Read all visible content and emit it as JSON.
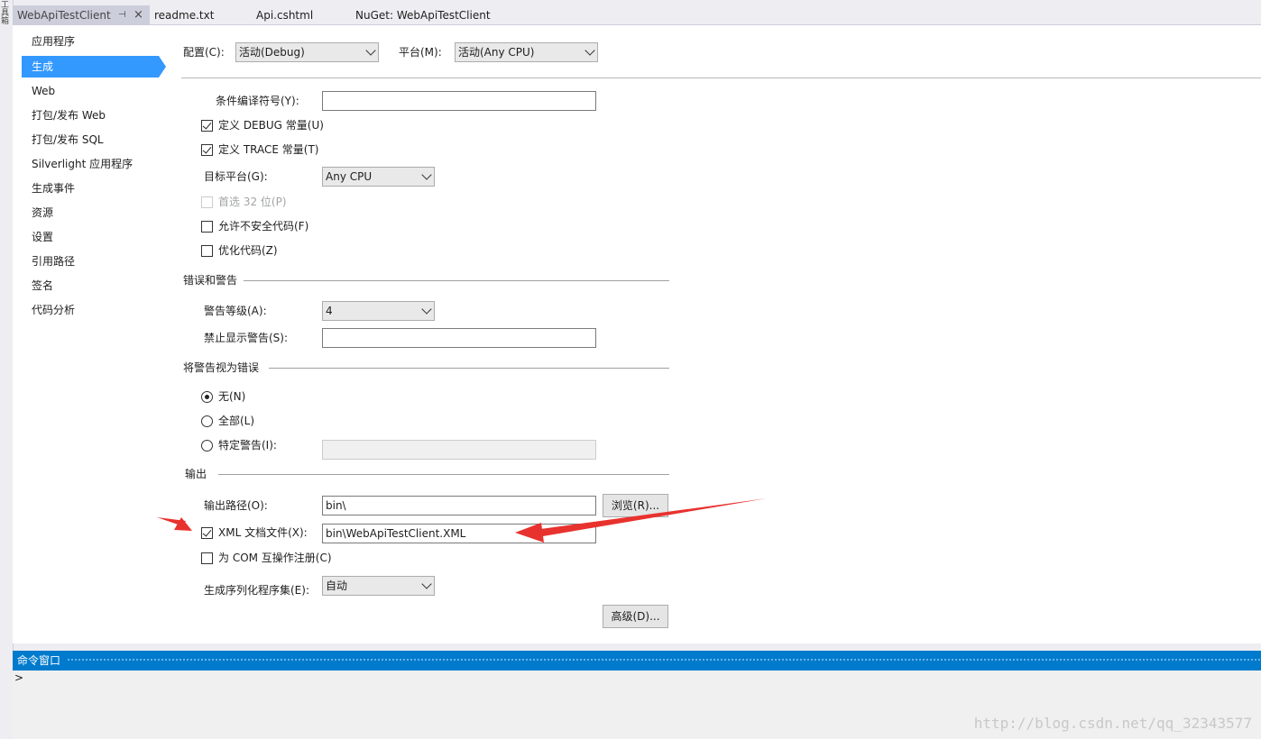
{
  "side_strip_text": "工具箱",
  "tabs": [
    {
      "label": "WebApiTestClient",
      "active": true
    },
    {
      "label": "readme.txt"
    },
    {
      "label": "Api.cshtml"
    },
    {
      "label": "NuGet: WebApiTestClient"
    }
  ],
  "tab_icons": {
    "pin": "pin-icon",
    "close": "close-icon"
  },
  "nav": {
    "items": [
      "应用程序",
      "生成",
      "Web",
      "打包/发布 Web",
      "打包/发布 SQL",
      "Silverlight 应用程序",
      "生成事件",
      "资源",
      "设置",
      "引用路径",
      "签名",
      "代码分析"
    ],
    "selected_index": 1
  },
  "config": {
    "config_label": "配置(C):",
    "config_value": "活动(Debug)",
    "platform_label": "平台(M):",
    "platform_value": "活动(Any CPU)"
  },
  "general": {
    "conditional_symbols_label": "条件编译符号(Y):",
    "conditional_symbols_value": "",
    "define_debug_label": "定义 DEBUG 常量(U)",
    "define_debug_checked": true,
    "define_trace_label": "定义 TRACE 常量(T)",
    "define_trace_checked": true,
    "target_platform_label": "目标平台(G):",
    "target_platform_value": "Any CPU",
    "prefer32_label": "首选 32 位(P)",
    "prefer32_checked": false,
    "prefer32_enabled": false,
    "unsafe_label": "允许不安全代码(F)",
    "unsafe_checked": false,
    "optimize_label": "优化代码(Z)",
    "optimize_checked": false
  },
  "errors": {
    "section_title": "错误和警告",
    "warning_level_label": "警告等级(A):",
    "warning_level_value": "4",
    "suppress_label": "禁止显示警告(S):",
    "suppress_value": ""
  },
  "treat_warnings": {
    "section_title": "将警告视为错误",
    "none_label": "无(N)",
    "all_label": "全部(L)",
    "specific_label": "特定警告(I):",
    "selected": "none",
    "specific_value": ""
  },
  "output": {
    "section_title": "输出",
    "path_label": "输出路径(O):",
    "path_value": "bin\\",
    "browse_label": "浏览(R)...",
    "xml_doc_label": "XML 文档文件(X):",
    "xml_doc_checked": true,
    "xml_doc_value": "bin\\WebApiTestClient.XML",
    "com_label": "为 COM 互操作注册(C)",
    "com_checked": false,
    "serialization_label": "生成序列化程序集(E):",
    "serialization_value": "自动",
    "advanced_label": "高级(D)..."
  },
  "command_window": {
    "title": "命令窗口",
    "prompt": ">"
  },
  "watermark": "http://blog.csdn.net/qq_32343577",
  "colors": {
    "accent": "#007acc",
    "nav_selected": "#3399ff",
    "annotation_arrow": "#e8322e"
  }
}
